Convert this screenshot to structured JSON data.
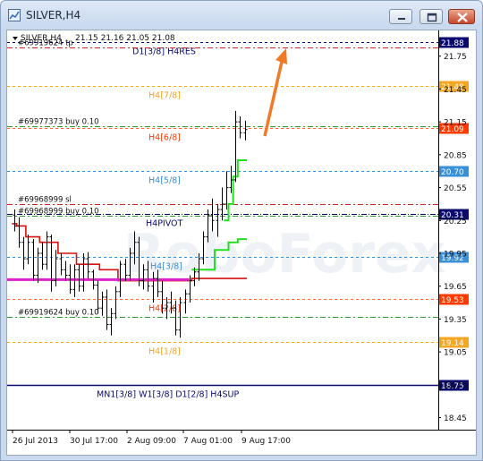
{
  "window": {
    "title": "SILVER,H4",
    "buttons": [
      "minimize",
      "restore",
      "close"
    ]
  },
  "chart_header": {
    "symbol": "SILVER,H4",
    "ohlc": "21.15 21.16 21.05 21.08"
  },
  "watermark": "RoboForex",
  "price_axis": {
    "ticks": [
      "21.75",
      "21.45",
      "21.15",
      "20.85",
      "20.55",
      "20.25",
      "19.95",
      "19.65",
      "19.35",
      "19.05",
      "18.75",
      "18.45"
    ]
  },
  "time_axis": {
    "ticks": [
      "26 Jul 2013",
      "30 Jul 17:00",
      "2 Aug 09:00",
      "7 Aug 01:00",
      "9 Aug 17:00"
    ]
  },
  "levels": [
    {
      "id": "d1-3-8-h4res",
      "price": 21.88,
      "badge": "21.88",
      "badge_color": "#0a0a6e",
      "line_color": "#0a0a6e",
      "label": "D1[3/8] H4RES",
      "label_color": "#0a0a6e"
    },
    {
      "id": "h4-7-8",
      "price": 21.48,
      "badge": "21.48",
      "badge_color": "#f5a623",
      "line_color": "#f5a623",
      "label": "H4[7/8]",
      "label_color": "#f5a623"
    },
    {
      "id": "h4-6-8",
      "price": 21.09,
      "badge": "21.09",
      "badge_color": "#ff3b00",
      "line_color": "#ff6a40",
      "label": "H4[6/8]",
      "label_color": "#ff3b00"
    },
    {
      "id": "h4-5-8",
      "price": 20.7,
      "badge": "20.70",
      "badge_color": "#3a8fd9",
      "line_color": "#3a8fd9",
      "label": "H4[5/8]",
      "label_color": "#3a8fd9"
    },
    {
      "id": "h4pivot",
      "price": 20.31,
      "badge": "20.31",
      "badge_color": "#0a0a6e",
      "line_color": "#0a0a6e",
      "label": "H4PIVOT",
      "label_color": "#0a0a6e"
    },
    {
      "id": "h4-3-8",
      "price": 19.92,
      "badge": "19.92",
      "badge_color": "#3a8fd9",
      "line_color": "#3a8fd9",
      "label": "H4[3/8]",
      "label_color": "#3a8fd9"
    },
    {
      "id": "h4-2-8",
      "price": 19.53,
      "badge": "19.53",
      "badge_color": "#ff3b00",
      "line_color": "#ff6a40",
      "label": "H4[2/8]",
      "label_color": "#ff3b00"
    },
    {
      "id": "h4-1-8",
      "price": 19.14,
      "badge": "19.14",
      "badge_color": "#f5a623",
      "line_color": "#f5a623",
      "label": "H4[1/8]",
      "label_color": "#f5a623"
    },
    {
      "id": "mn1-h4sup",
      "price": 18.75,
      "badge": "18.75",
      "badge_color": "#0a0a6e",
      "line_color": "#0a0a6e",
      "label": "MN1[3/8] W1[3/8] D1[2/8] H4SUP",
      "label_color": "#0a0a6e"
    }
  ],
  "orders": [
    {
      "id": "order-top",
      "price": 21.83,
      "label": "#69919624 tp"
    },
    {
      "id": "order-buy-1",
      "price": 21.11,
      "label": "#69977373 buy 0.10"
    },
    {
      "id": "order-sl",
      "price": 20.4,
      "label": "#69968999 sl"
    },
    {
      "id": "order-buy-2",
      "price": 20.29,
      "label": "#69968999 buy 0.10"
    },
    {
      "id": "order-buy-3",
      "price": 19.37,
      "label": "#69919624 buy 0.10"
    }
  ],
  "price_scale": {
    "top_price": 21.96,
    "bottom_price": 18.34
  },
  "candles": [
    [
      20.3,
      20.35,
      20.15,
      20.2
    ],
    [
      20.2,
      20.28,
      20.0,
      20.05
    ],
    [
      20.05,
      20.1,
      19.8,
      19.9
    ],
    [
      19.9,
      20.12,
      19.85,
      20.05
    ],
    [
      20.05,
      20.08,
      19.7,
      19.75
    ],
    [
      19.75,
      20.0,
      19.68,
      19.95
    ],
    [
      19.95,
      20.05,
      19.8,
      19.85
    ],
    [
      19.85,
      20.15,
      19.8,
      20.1
    ],
    [
      20.1,
      20.12,
      19.6,
      19.7
    ],
    [
      19.7,
      19.98,
      19.65,
      19.9
    ],
    [
      19.9,
      19.95,
      19.75,
      19.8
    ],
    [
      19.8,
      19.88,
      19.7,
      19.75
    ],
    [
      19.75,
      19.85,
      19.58,
      19.62
    ],
    [
      19.62,
      19.85,
      19.55,
      19.8
    ],
    [
      19.8,
      19.85,
      19.6,
      19.65
    ],
    [
      19.65,
      19.95,
      19.6,
      19.9
    ],
    [
      19.9,
      19.96,
      19.72,
      19.78
    ],
    [
      19.78,
      19.8,
      19.62,
      19.66
    ],
    [
      19.66,
      19.7,
      19.4,
      19.45
    ],
    [
      19.45,
      19.6,
      19.38,
      19.55
    ],
    [
      19.55,
      19.62,
      19.25,
      19.3
    ],
    [
      19.3,
      19.45,
      19.2,
      19.4
    ],
    [
      19.4,
      19.65,
      19.35,
      19.6
    ],
    [
      19.6,
      19.88,
      19.55,
      19.85
    ],
    [
      19.85,
      19.9,
      19.7,
      19.75
    ],
    [
      19.75,
      20.0,
      19.7,
      19.95
    ],
    [
      19.95,
      20.15,
      19.85,
      20.05
    ],
    [
      20.05,
      20.1,
      19.65,
      19.7
    ],
    [
      19.7,
      19.85,
      19.62,
      19.8
    ],
    [
      19.8,
      19.88,
      19.6,
      19.65
    ],
    [
      19.65,
      19.78,
      19.5,
      19.72
    ],
    [
      19.72,
      19.8,
      19.55,
      19.6
    ],
    [
      19.6,
      19.7,
      19.4,
      19.45
    ],
    [
      19.45,
      19.55,
      19.35,
      19.5
    ],
    [
      19.5,
      19.6,
      19.4,
      19.45
    ],
    [
      19.45,
      19.52,
      19.2,
      19.25
    ],
    [
      19.25,
      19.55,
      19.18,
      19.5
    ],
    [
      19.5,
      19.62,
      19.4,
      19.58
    ],
    [
      19.58,
      19.75,
      19.5,
      19.7
    ],
    [
      19.7,
      19.82,
      19.65,
      19.78
    ],
    [
      19.78,
      19.95,
      19.7,
      19.9
    ],
    [
      19.9,
      20.15,
      19.85,
      20.1
    ],
    [
      20.1,
      20.35,
      20.05,
      20.3
    ],
    [
      20.3,
      20.45,
      20.15,
      20.25
    ],
    [
      20.25,
      20.4,
      20.1,
      20.35
    ],
    [
      20.35,
      20.55,
      20.25,
      20.4
    ],
    [
      20.4,
      20.7,
      20.35,
      20.55
    ],
    [
      20.55,
      20.75,
      20.5,
      20.62
    ],
    [
      20.62,
      21.25,
      20.6,
      21.15
    ],
    [
      21.15,
      21.2,
      21.0,
      21.05
    ],
    [
      21.05,
      21.16,
      20.98,
      21.08
    ]
  ],
  "indicator_upper_stair": [
    20.22,
    20.2,
    20.2,
    20.1,
    20.1,
    20.1,
    20.05,
    20.05,
    20.05,
    20.05,
    19.95,
    19.95,
    19.95,
    19.95,
    19.85,
    19.85,
    19.85,
    19.85,
    19.85,
    19.8,
    19.8,
    19.8,
    19.8,
    19.7,
    19.7,
    19.7,
    19.7,
    19.7,
    19.7,
    19.7,
    19.7,
    19.7,
    19.7,
    19.7,
    19.7,
    19.7,
    19.7,
    19.7,
    19.7,
    19.72,
    19.72,
    19.72,
    19.72,
    19.72,
    19.72,
    19.72,
    19.72,
    19.72,
    19.72,
    19.72,
    19.72
  ],
  "indicator_magenta": 19.71,
  "indicator_green_lower": [
    null,
    null,
    null,
    null,
    null,
    null,
    null,
    null,
    null,
    null,
    null,
    null,
    null,
    null,
    null,
    null,
    null,
    null,
    null,
    null,
    null,
    null,
    null,
    null,
    null,
    null,
    null,
    null,
    null,
    null,
    null,
    null,
    null,
    null,
    null,
    null,
    null,
    null,
    null,
    19.8,
    19.8,
    19.8,
    19.8,
    19.8,
    19.98,
    19.98,
    19.98,
    20.05,
    20.05,
    20.08,
    20.08
  ],
  "indicator_green_upper": [
    null,
    null,
    null,
    null,
    null,
    null,
    null,
    null,
    null,
    null,
    null,
    null,
    null,
    null,
    null,
    null,
    null,
    null,
    null,
    null,
    null,
    null,
    null,
    null,
    null,
    null,
    null,
    null,
    null,
    null,
    null,
    null,
    null,
    null,
    null,
    null,
    null,
    null,
    null,
    null,
    null,
    null,
    null,
    null,
    null,
    null,
    20.25,
    20.4,
    20.65,
    20.8,
    20.8
  ]
}
